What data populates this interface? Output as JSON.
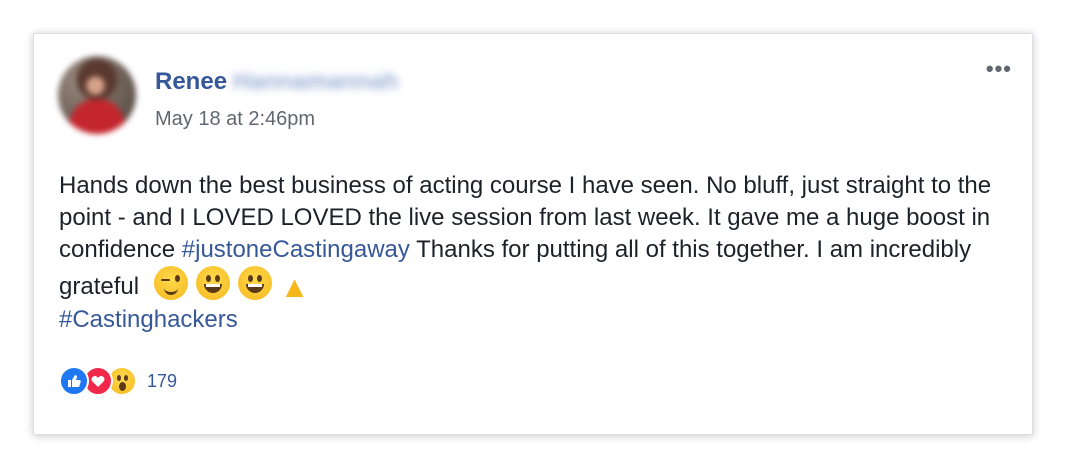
{
  "post": {
    "author_first_name": "Renee",
    "author_last_name_blurred": "Hannamannah",
    "timestamp": "May 18 at 2:46pm",
    "more_label": "•••",
    "text_main": "Hands down the best business of acting course I have seen. No bluff, just straight to the point - and I LOVED LOVED the live session from last week. It gave me a huge boost in confidence ",
    "hashtag_1": "#justoneCastingaway",
    "text_after_hashtag": " Thanks for putting all of this together. I am incredibly grateful",
    "hashtag_2": "#Castinghackers",
    "emojis": [
      "winking-face-icon",
      "grinning-face-icon",
      "grinning-face-icon",
      "folded-hands-icon"
    ]
  },
  "reactions": {
    "types": [
      "like-icon",
      "love-icon",
      "wow-icon"
    ],
    "count": "179"
  },
  "colors": {
    "link_blue": "#365899",
    "text": "#1d2129",
    "muted": "#616770",
    "like_blue": "#1f78f2",
    "love_red": "#f0284a"
  }
}
